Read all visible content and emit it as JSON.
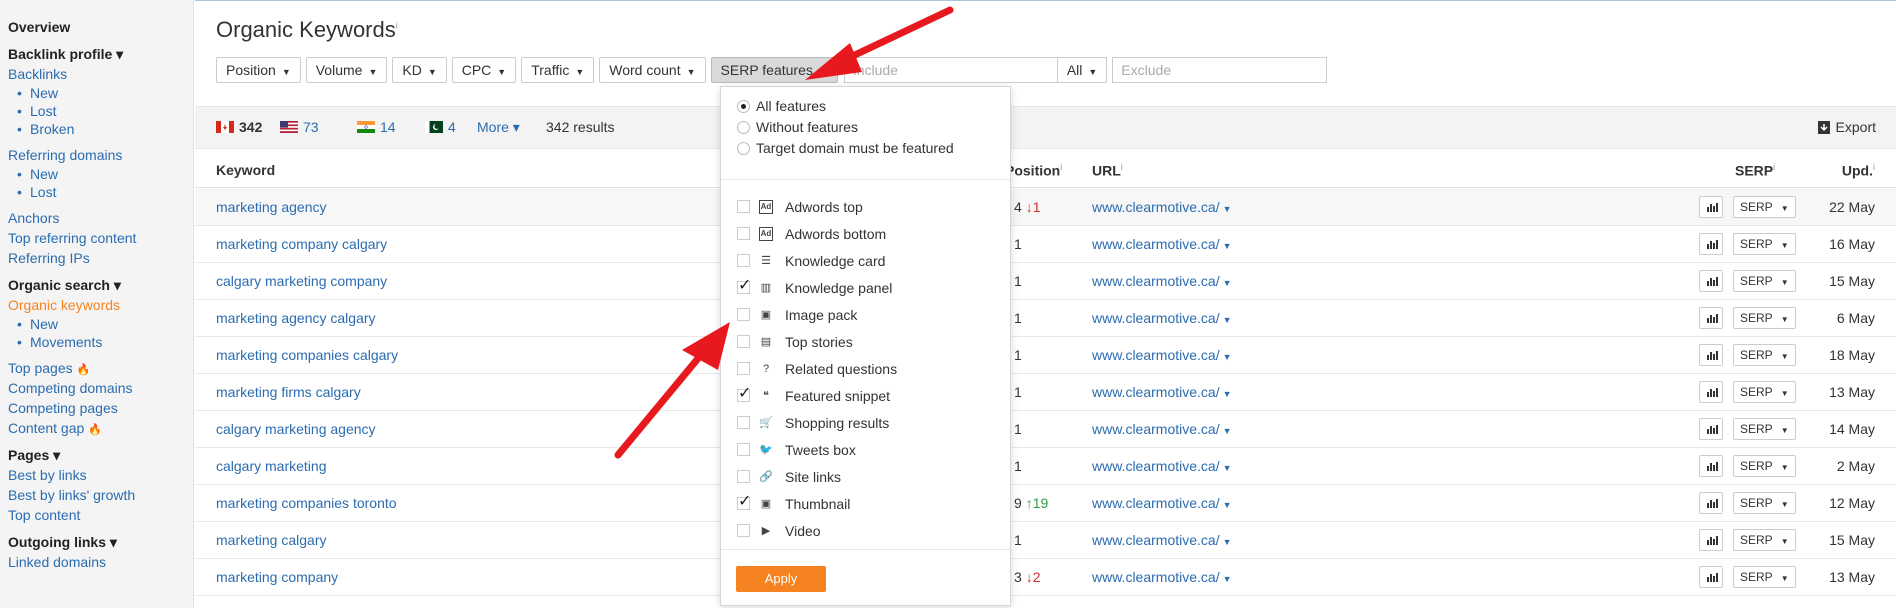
{
  "sidebar": {
    "overview": "Overview",
    "backlink_profile": "Backlink profile ▾",
    "backlinks": "Backlinks",
    "backlinks_new": "New",
    "backlinks_lost": "Lost",
    "backlinks_broken": "Broken",
    "referring_domains": "Referring domains",
    "rd_new": "New",
    "rd_lost": "Lost",
    "anchors": "Anchors",
    "top_referring_content": "Top referring content",
    "referring_ips": "Referring IPs",
    "organic_search": "Organic search ▾",
    "organic_keywords": "Organic keywords",
    "ok_new": "New",
    "ok_movements": "Movements",
    "top_pages": "Top pages",
    "competing_domains": "Competing domains",
    "competing_pages": "Competing pages",
    "content_gap": "Content gap",
    "pages": "Pages ▾",
    "best_by_links": "Best by links",
    "best_by_links_growth": "Best by links' growth",
    "top_content": "Top content",
    "outgoing_links": "Outgoing links ▾",
    "linked_domains": "Linked domains"
  },
  "header": {
    "title": "Organic Keywords",
    "info": "i"
  },
  "filters": {
    "position": "Position",
    "volume": "Volume",
    "kd": "KD",
    "cpc": "CPC",
    "traffic": "Traffic",
    "word_count": "Word count",
    "serp_features": "SERP features",
    "include_placeholder": "Include",
    "all": "All",
    "exclude_placeholder": "Exclude"
  },
  "stats": {
    "ca": "342",
    "us": "73",
    "in": "14",
    "pk": "4",
    "more": "More ▾",
    "results": "342 results",
    "export": "Export"
  },
  "table": {
    "headers": {
      "keyword": "Keyword",
      "position": "Position",
      "url": "URL",
      "serp": "SERP",
      "upd": "Upd."
    },
    "rows": [
      {
        "keyword": "marketing agency",
        "pos": "4",
        "change": "↓1",
        "dir": "down",
        "url": "www.clearmotive.ca/",
        "serp": "SERP",
        "upd": "22 May"
      },
      {
        "keyword": "marketing company calgary",
        "pos": "1",
        "change": "",
        "dir": "",
        "url": "www.clearmotive.ca/",
        "serp": "SERP",
        "upd": "16 May"
      },
      {
        "keyword": "calgary marketing company",
        "pos": "1",
        "change": "",
        "dir": "",
        "url": "www.clearmotive.ca/",
        "serp": "SERP",
        "upd": "15 May"
      },
      {
        "keyword": "marketing agency calgary",
        "pos": "1",
        "change": "",
        "dir": "",
        "url": "www.clearmotive.ca/",
        "serp": "SERP",
        "upd": "6 May"
      },
      {
        "keyword": "marketing companies calgary",
        "pos": "1",
        "change": "",
        "dir": "",
        "url": "www.clearmotive.ca/",
        "serp": "SERP",
        "upd": "18 May"
      },
      {
        "keyword": "marketing firms calgary",
        "pos": "1",
        "change": "",
        "dir": "",
        "url": "www.clearmotive.ca/",
        "serp": "SERP",
        "upd": "13 May"
      },
      {
        "keyword": "calgary marketing agency",
        "pos": "1",
        "change": "",
        "dir": "",
        "url": "www.clearmotive.ca/",
        "serp": "SERP",
        "upd": "14 May"
      },
      {
        "keyword": "calgary marketing",
        "pos": "1",
        "change": "",
        "dir": "",
        "url": "www.clearmotive.ca/",
        "serp": "SERP",
        "upd": "2 May"
      },
      {
        "keyword": "marketing companies toronto",
        "pos": "9",
        "change": "↑19",
        "dir": "up",
        "url": "www.clearmotive.ca/",
        "serp": "SERP",
        "upd": "12 May"
      },
      {
        "keyword": "marketing calgary",
        "pos": "1",
        "change": "",
        "dir": "",
        "url": "www.clearmotive.ca/",
        "serp": "SERP",
        "upd": "15 May"
      },
      {
        "keyword": "marketing company",
        "pos": "3",
        "change": "↓2",
        "dir": "down",
        "url": "www.clearmotive.ca/",
        "serp": "SERP",
        "upd": "13 May"
      }
    ]
  },
  "dropdown": {
    "radios": [
      "All features",
      "Without features",
      "Target domain must be featured"
    ],
    "features": [
      {
        "label": "Adwords top",
        "checked": false,
        "icon": "ad-icon"
      },
      {
        "label": "Adwords bottom",
        "checked": false,
        "icon": "ad-icon"
      },
      {
        "label": "Knowledge card",
        "checked": false,
        "icon": "card-icon"
      },
      {
        "label": "Knowledge panel",
        "checked": true,
        "icon": "panel-icon"
      },
      {
        "label": "Image pack",
        "checked": false,
        "icon": "image-icon"
      },
      {
        "label": "Top stories",
        "checked": false,
        "icon": "news-icon"
      },
      {
        "label": "Related questions",
        "checked": false,
        "icon": "question-icon"
      },
      {
        "label": "Featured snippet",
        "checked": true,
        "icon": "quote-icon"
      },
      {
        "label": "Shopping results",
        "checked": false,
        "icon": "cart-icon"
      },
      {
        "label": "Tweets box",
        "checked": false,
        "icon": "twitter-icon"
      },
      {
        "label": "Site links",
        "checked": false,
        "icon": "link-icon"
      },
      {
        "label": "Thumbnail",
        "checked": true,
        "icon": "image-icon"
      },
      {
        "label": "Video",
        "checked": false,
        "icon": "video-icon"
      }
    ],
    "apply": "Apply"
  },
  "colors": {
    "accent": "#f5831f",
    "link": "#2b6cb0",
    "arrow": "#e8191e"
  }
}
